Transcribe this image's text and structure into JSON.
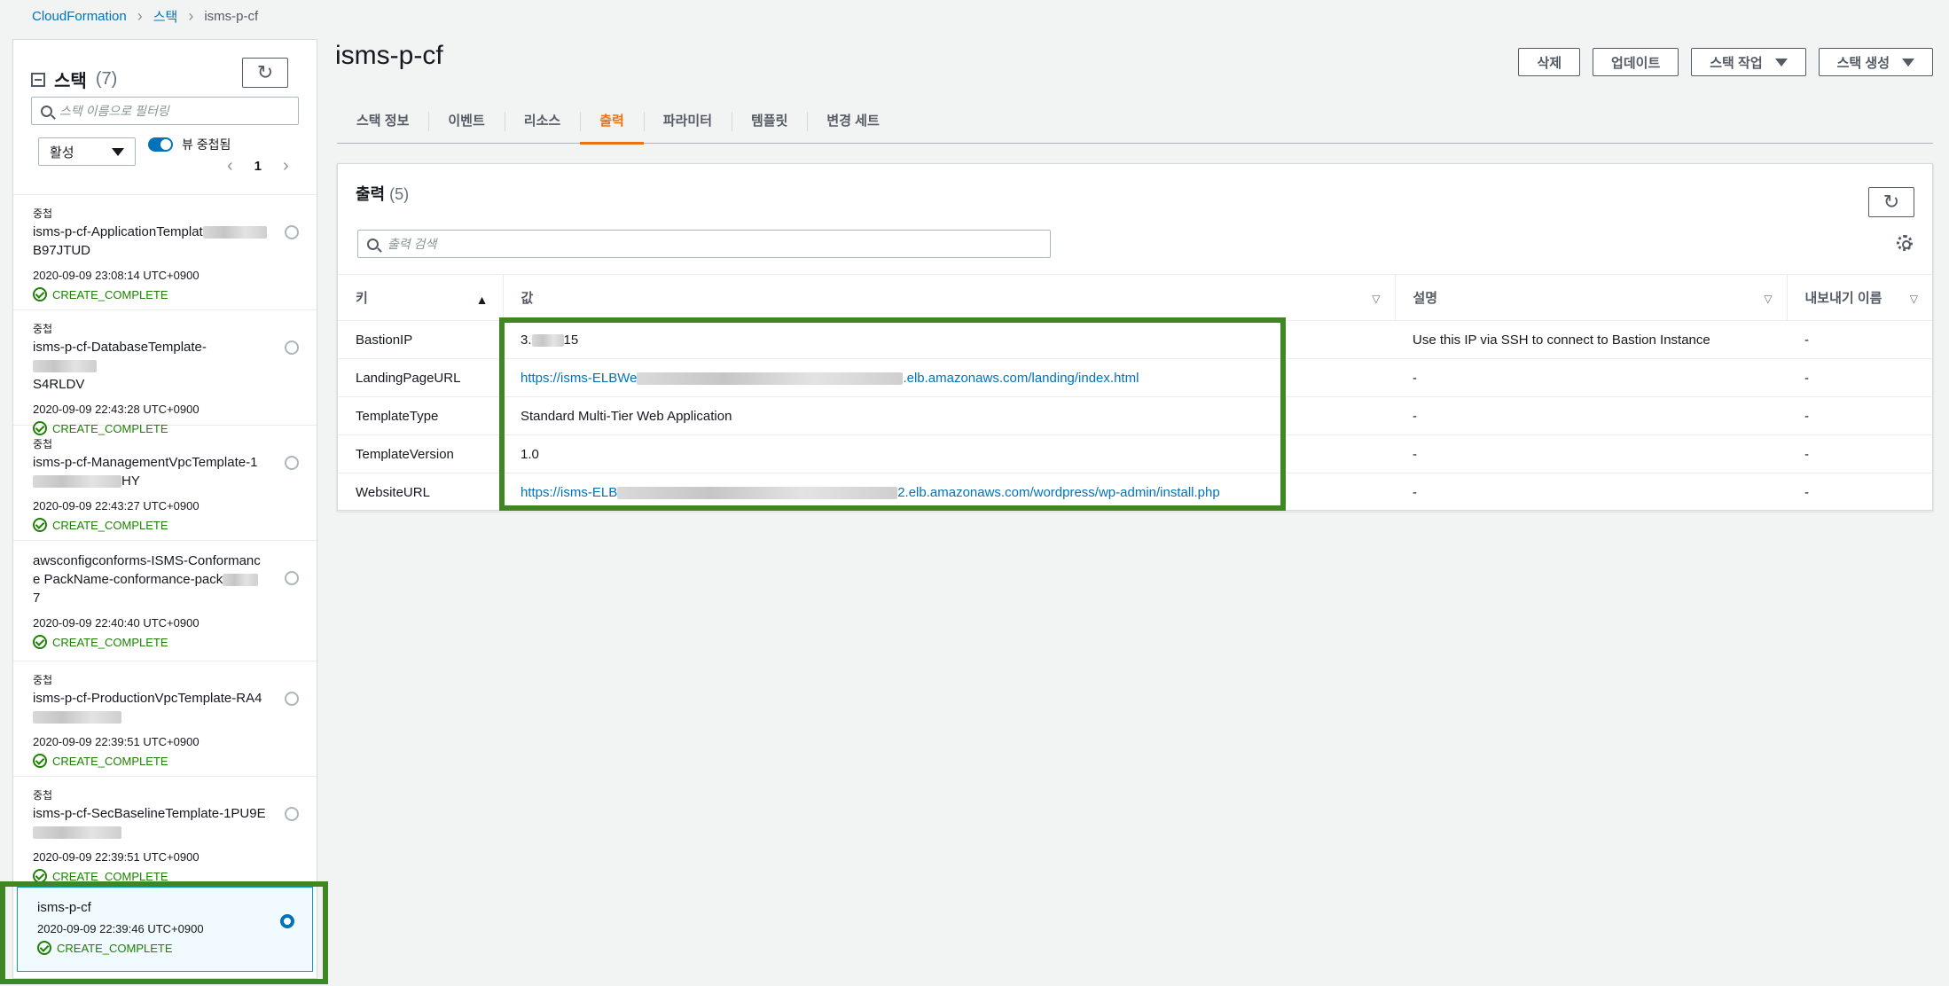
{
  "breadcrumb": {
    "root": "CloudFormation",
    "section": "스택",
    "current": "isms-p-cf"
  },
  "sidebar": {
    "title": "스택",
    "count": "(7)",
    "filter_placeholder": "스택 이름으로 필터링",
    "status_filter": "활성",
    "toggle_label": "뷰 중첩됨",
    "page": "1",
    "stacks": [
      {
        "nested": "중첩",
        "name": "isms-p-cf-ApplicationTemplat",
        "name_tail": "B97JTUD",
        "time": "2020-09-09 23:08:14 UTC+0900",
        "status": "CREATE_COMPLETE"
      },
      {
        "nested": "중첩",
        "name": "isms-p-cf-DatabaseTemplate-",
        "name_tail": "S4RLDV",
        "time": "2020-09-09 22:43:28 UTC+0900",
        "status": "CREATE_COMPLETE"
      },
      {
        "nested": "중첩",
        "name": "isms-p-cf-ManagementVpcTemplate-1",
        "name_tail": "HY",
        "time": "2020-09-09 22:43:27 UTC+0900",
        "status": "CREATE_COMPLETE"
      },
      {
        "nested": "",
        "name": "awsconfigconforms-ISMS-Conformance PackName-conformance-pack",
        "name_tail": "7",
        "time": "2020-09-09 22:40:40 UTC+0900",
        "status": "CREATE_COMPLETE"
      },
      {
        "nested": "중첩",
        "name": "isms-p-cf-ProductionVpcTemplate-RA4",
        "name_tail": "",
        "time": "2020-09-09 22:39:51 UTC+0900",
        "status": "CREATE_COMPLETE"
      },
      {
        "nested": "중첩",
        "name": "isms-p-cf-SecBaselineTemplate-1PU9E",
        "name_tail": "",
        "time": "2020-09-09 22:39:51 UTC+0900",
        "status": "CREATE_COMPLETE"
      },
      {
        "nested": "",
        "name": "isms-p-cf",
        "name_tail": "",
        "time": "2020-09-09 22:39:46 UTC+0900",
        "status": "CREATE_COMPLETE"
      }
    ]
  },
  "main": {
    "title": "isms-p-cf",
    "actions": {
      "delete": "삭제",
      "update": "업데이트",
      "stack_actions": "스택 작업",
      "create_stack": "스택 생성"
    },
    "tabs": [
      "스택 정보",
      "이벤트",
      "리소스",
      "출력",
      "파라미터",
      "템플릿",
      "변경 세트"
    ],
    "active_tab": "출력"
  },
  "outputs": {
    "title": "출력",
    "count": "(5)",
    "search_placeholder": "출력 검색",
    "columns": {
      "key": "키",
      "value": "값",
      "description": "설명",
      "export": "내보내기 이름"
    },
    "rows": [
      {
        "key": "BastionIP",
        "value_prefix": "3.",
        "value_suffix": "15",
        "description": "Use this IP via SSH to connect to Bastion Instance",
        "export": "-"
      },
      {
        "key": "LandingPageURL",
        "value_prefix": "https://isms-ELBWe",
        "value_suffix": ".elb.amazonaws.com/landing/index.html",
        "description": "-",
        "export": "-"
      },
      {
        "key": "TemplateType",
        "value_prefix": "Standard Multi-Tier Web Application",
        "value_suffix": "",
        "description": "-",
        "export": "-"
      },
      {
        "key": "TemplateVersion",
        "value_prefix": "1.0",
        "value_suffix": "",
        "description": "-",
        "export": "-"
      },
      {
        "key": "WebsiteURL",
        "value_prefix": "https://isms-ELB",
        "value_suffix": "2.elb.amazonaws.com/wordpress/wp-admin/install.php",
        "description": "-",
        "export": "-"
      }
    ]
  },
  "colors": {
    "accent": "#ec7211",
    "link": "#0073bb",
    "success": "#1d8102",
    "highlight": "#3f8624"
  }
}
